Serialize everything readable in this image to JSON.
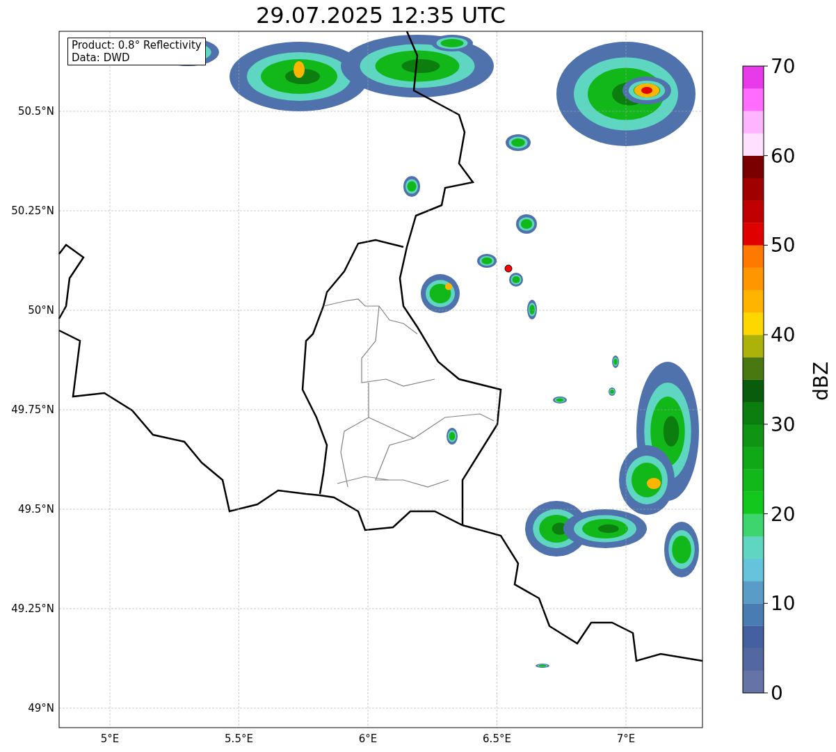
{
  "title": "29.07.2025 12:35 UTC",
  "info_box": {
    "lines": [
      "Product: 0.8° Reflectivity",
      "Data: DWD"
    ]
  },
  "map": {
    "lat_ticks": [
      "50.5°N",
      "50.25°N",
      "50°N",
      "49.75°N",
      "49.5°N",
      "49.25°N",
      "49°N"
    ],
    "lon_ticks": [
      "5°E",
      "5.5°E",
      "6°E",
      "6.5°E",
      "7°E"
    ]
  },
  "colorbar": {
    "label": "dBZ",
    "ticks": [
      "70",
      "60",
      "50",
      "40",
      "30",
      "20",
      "10",
      "0"
    ],
    "segments": [
      {
        "color": "#6673a6"
      },
      {
        "color": "#5367a0"
      },
      {
        "color": "#4560a0"
      },
      {
        "color": "#4a7cb4"
      },
      {
        "color": "#5a9cc8"
      },
      {
        "color": "#66c3dc"
      },
      {
        "color": "#5fd6c1"
      },
      {
        "color": "#3dd66e"
      },
      {
        "color": "#12c81c"
      },
      {
        "color": "#12b81a"
      },
      {
        "color": "#10a816"
      },
      {
        "color": "#0f9414"
      },
      {
        "color": "#0c7e10"
      },
      {
        "color": "#085c0c"
      },
      {
        "color": "#497810"
      },
      {
        "color": "#adb20a"
      },
      {
        "color": "#ffd700"
      },
      {
        "color": "#ffb400"
      },
      {
        "color": "#ff9600"
      },
      {
        "color": "#ff7800"
      },
      {
        "color": "#e00000"
      },
      {
        "color": "#c00000"
      },
      {
        "color": "#a00000"
      },
      {
        "color": "#7a0000"
      },
      {
        "color": "#ffe0ff"
      },
      {
        "color": "#ffb4ff"
      },
      {
        "color": "#ff6cff"
      },
      {
        "color": "#e83ae8"
      }
    ]
  }
}
